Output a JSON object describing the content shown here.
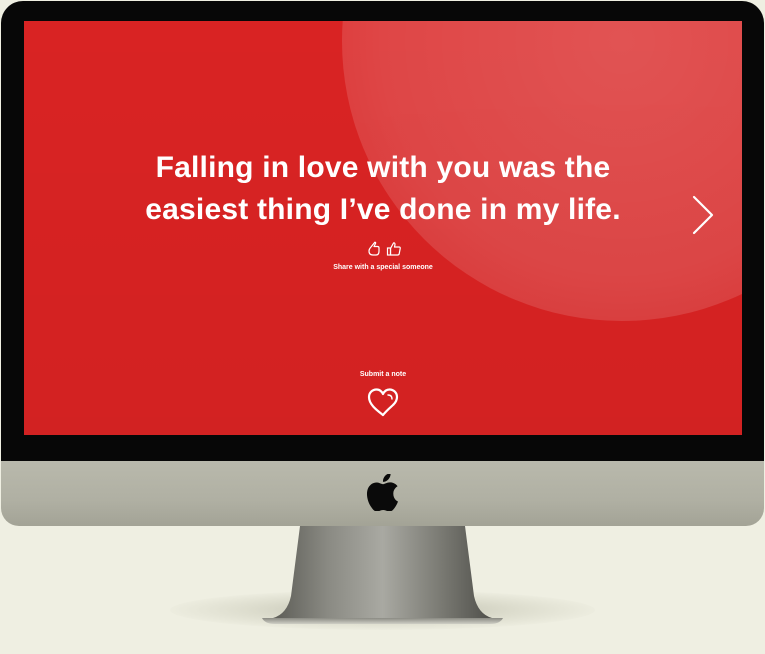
{
  "screen": {
    "quote_line1": "Falling in love with you was the",
    "quote_line2": "easiest thing I’ve done in my life.",
    "share_text": "Share with a special someone",
    "submit_label": "Submit a note"
  },
  "icons": {
    "reaction_left": "hand-wave-icon",
    "reaction_right": "thumbs-up-icon",
    "next": "chevron-right-icon",
    "submit": "heart-icon",
    "brand": "apple-logo-icon"
  },
  "colors": {
    "screen_red": "#d92323",
    "bezel": "#070707",
    "chin_silver": "#b0b0a3",
    "background": "#efefe2",
    "text": "#ffffff"
  }
}
